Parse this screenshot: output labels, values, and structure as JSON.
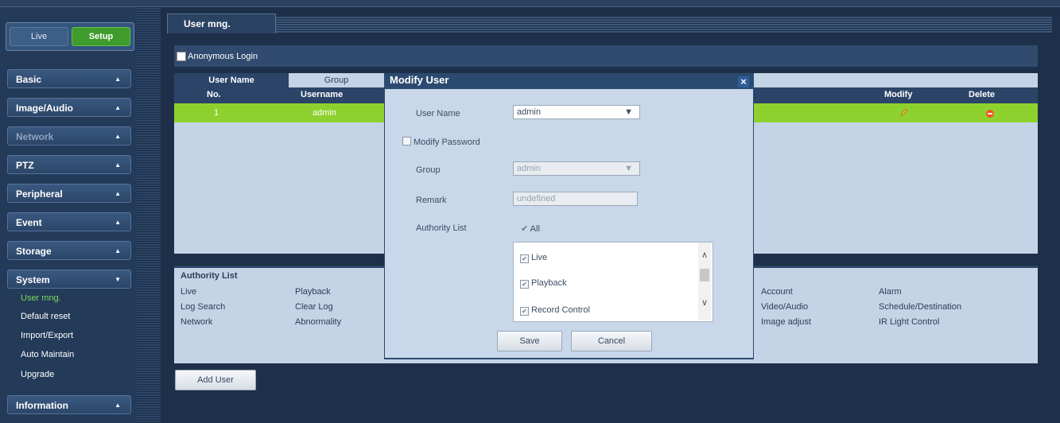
{
  "mode": {
    "live": "Live",
    "setup": "Setup"
  },
  "menu": [
    {
      "label": "Basic",
      "dim": false
    },
    {
      "label": "Image/Audio",
      "dim": false
    },
    {
      "label": "Network",
      "dim": true
    },
    {
      "label": "PTZ",
      "dim": false
    },
    {
      "label": "Peripheral",
      "dim": false
    },
    {
      "label": "Event",
      "dim": false
    },
    {
      "label": "Storage",
      "dim": false
    },
    {
      "label": "System",
      "dim": false
    },
    {
      "label": "Information",
      "dim": false
    }
  ],
  "system_sub": [
    "User mng.",
    "Default reset",
    "Import/Export",
    "Auto Maintain",
    "Upgrade"
  ],
  "page_tab": "User mng.",
  "anonymous_login": "Anonymous Login",
  "subtabs": {
    "user_name": "User Name",
    "group": "Group"
  },
  "table": {
    "headers": {
      "no": "No.",
      "username": "Username",
      "modify": "Modify",
      "delete": "Delete"
    },
    "rows": [
      {
        "no": "1",
        "username": "admin"
      }
    ]
  },
  "authority_panel": {
    "title": "Authority List",
    "col1": [
      "Live",
      "Log Search",
      "Network"
    ],
    "col2": [
      "Playback",
      "Clear Log",
      "Abnormality"
    ],
    "col3": [
      "Account",
      "Video/Audio",
      "Image adjust"
    ],
    "col4": [
      "Alarm",
      "Schedule/Destination",
      "IR Light Control"
    ]
  },
  "add_user": "Add User",
  "modal": {
    "title": "Modify User",
    "close": "×",
    "user_name_label": "User Name",
    "user_name_value": "admin",
    "modify_password": "Modify Password",
    "group_label": "Group",
    "group_value": "admin",
    "remark_label": "Remark",
    "remark_value": "undefined",
    "authority_label": "Authority List",
    "all_label": "All",
    "permissions": [
      "Live",
      "Playback",
      "Record Control"
    ],
    "save": "Save",
    "cancel": "Cancel"
  },
  "colors": {
    "accent": "#8ed12e",
    "setup_green": "#3e9b2c",
    "navy": "#2b4468"
  }
}
